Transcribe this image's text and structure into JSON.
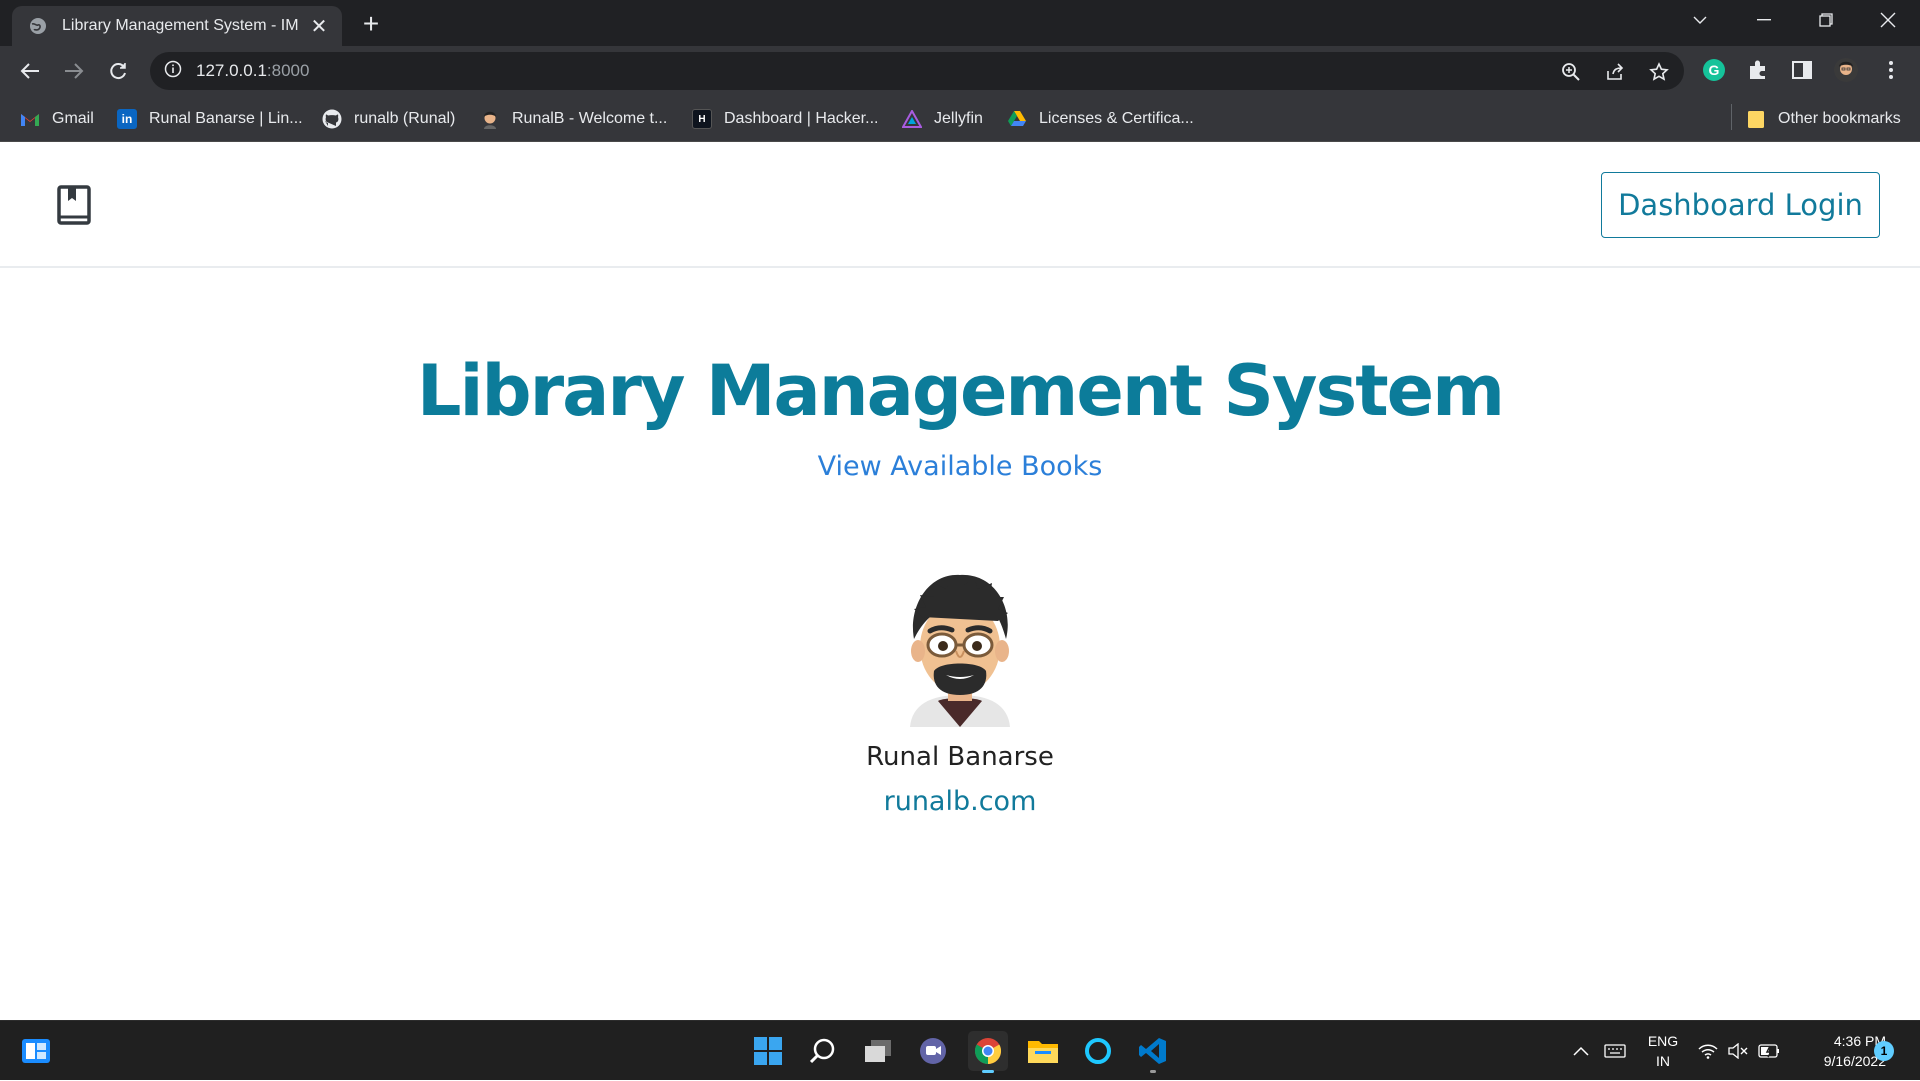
{
  "browser": {
    "tab_title": "Library Management System - IM",
    "url_host": "127.0.0.1",
    "url_port": ":8000",
    "bookmarks": [
      {
        "label": "Gmail",
        "icon": "gmail-icon"
      },
      {
        "label": "Runal Banarse | Lin...",
        "icon": "linkedin-icon"
      },
      {
        "label": "runalb (Runal)",
        "icon": "github-icon"
      },
      {
        "label": "RunalB - Welcome t...",
        "icon": "avatar-icon"
      },
      {
        "label": "Dashboard | Hacker...",
        "icon": "hackerrank-icon"
      },
      {
        "label": "Jellyfin",
        "icon": "jellyfin-icon"
      },
      {
        "label": "Licenses & Certifica...",
        "icon": "google-drive-icon"
      }
    ],
    "other_bookmarks": "Other bookmarks"
  },
  "navbar": {
    "brand_icon": "bookmark-book-icon",
    "login_label": "Dashboard Login"
  },
  "hero": {
    "title": "Library Management System",
    "view_books": "View Available Books"
  },
  "author": {
    "name": "Runal Banarse",
    "site": "runalb.com"
  },
  "taskbar": {
    "lang_line1": "ENG",
    "lang_line2": "IN",
    "time": "4:36 PM",
    "date": "9/16/2022",
    "notifications": "1"
  },
  "colors": {
    "accent": "#117a9b",
    "title": "#0c7c9a",
    "link": "#2b7fd9"
  }
}
